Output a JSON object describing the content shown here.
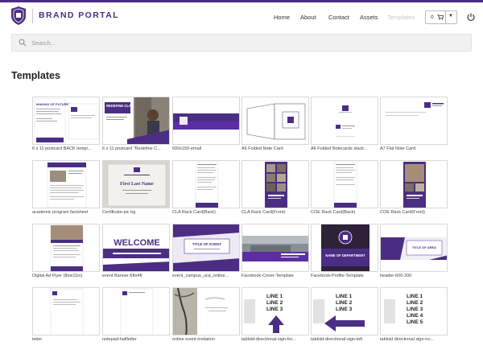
{
  "header": {
    "brand": "BRAND PORTAL",
    "nav": [
      {
        "label": "Home",
        "disabled": false
      },
      {
        "label": "About",
        "disabled": false
      },
      {
        "label": "Contact",
        "disabled": false
      },
      {
        "label": "Assets",
        "disabled": false
      },
      {
        "label": "Templates",
        "disabled": true
      }
    ],
    "cart_count": "0",
    "cart_icon": "cart-icon",
    "power_icon": "power-icon"
  },
  "search": {
    "placeholder": "Search..."
  },
  "page_title": "Templates",
  "colors": {
    "brand_purple": "#4b2e83",
    "accent_purple": "#5b2ea6"
  },
  "templates": [
    {
      "caption": "6 x 11 postcard BACK templ...",
      "thumb_text": "MAKING OF FUTURES"
    },
    {
      "caption": "6 x 11 postcard \"Redefine C...",
      "thumb_text": "REDEFINE CLASSROOM"
    },
    {
      "caption": "600x150-email",
      "thumb_text": ""
    },
    {
      "caption": "A6 Folded Note Card",
      "thumb_text": ""
    },
    {
      "caption": "A6 Folded Notecards stack...",
      "thumb_text": ""
    },
    {
      "caption": "A7 Flat Note Card",
      "thumb_text": ""
    },
    {
      "caption": "academic program factsheet",
      "thumb_text": ""
    },
    {
      "caption": "Certificate-pic bg",
      "thumb_text": "First Last Name"
    },
    {
      "caption": "CLA Rack Card(Back)",
      "thumb_text": ""
    },
    {
      "caption": "CLA Rack Card(Front)",
      "thumb_text": ""
    },
    {
      "caption": "COE Rack Card(Back)",
      "thumb_text": ""
    },
    {
      "caption": "COE Rack Card(Front)",
      "thumb_text": ""
    },
    {
      "caption": "Digital Ad Flyer (8inx11in)",
      "thumb_text": ""
    },
    {
      "caption": "event Banner-6ftx4ft",
      "thumb_text": "WELCOME"
    },
    {
      "caption": "event_campus_uca_online...",
      "thumb_text": "TITLE OF EVENT"
    },
    {
      "caption": "Facebook-Cover-Template",
      "thumb_text": ""
    },
    {
      "caption": "Facebook-Profile-Template",
      "thumb_text": "NAME OF DEPARTMENT"
    },
    {
      "caption": "header-600-200",
      "thumb_text": "TITLE OF AREA"
    },
    {
      "caption": "letter",
      "thumb_text": ""
    },
    {
      "caption": "notepad-halfletter",
      "thumb_text": ""
    },
    {
      "caption": "online event invitation",
      "thumb_text": ""
    },
    {
      "caption": "tabloid-directional-sign-for...",
      "thumb_text": "LINE 1|LINE 2|LINE 3"
    },
    {
      "caption": "tabloid-directional-sign-left",
      "thumb_text": "LINE 1|LINE 2|LINE 3"
    },
    {
      "caption": "tabloid directional sign-no...",
      "thumb_text": "LINE 1|LINE 2|LINE 3|LINE 4|LINE 5"
    }
  ]
}
